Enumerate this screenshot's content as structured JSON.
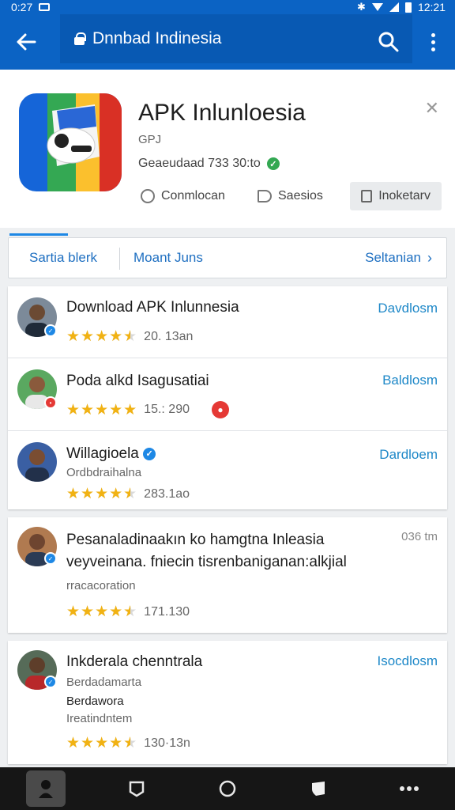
{
  "status_bar": {
    "time": "0:27",
    "right_time": "12:21"
  },
  "app_bar": {
    "title": "Dnnbad Indinesia"
  },
  "app": {
    "title": "APK Inlunloesia",
    "developer": "GPJ",
    "meta": "Geaeudaad 733 30:to",
    "actions": {
      "comment": "Conmlocan",
      "share": "Saesios",
      "install": "Inoketarv"
    }
  },
  "filters": {
    "first": "Sartia blerk",
    "second": "Moant Juns",
    "third": "Seltanian"
  },
  "list_cards": [
    {
      "rows": [
        {
          "title": "Download APK Inlunnesia",
          "rating": 4.5,
          "count": "20. 13an",
          "action": "Davdlosm",
          "badge": "blue"
        },
        {
          "title": "Poda alkd Isagusatiai",
          "rating": 5,
          "count": "15.: 290",
          "action": "Baldlosm",
          "badge": "red"
        },
        {
          "title": "Willagioela",
          "subtitle": "Ordbdraihalna",
          "rating": 4.5,
          "count": "283.1ao",
          "action": "Dardloem",
          "badge": "blue"
        }
      ]
    },
    {
      "rows": [
        {
          "title": "Pesanaladinaakın ko hamgtna Inleasia",
          "line2": "veyveinana. fniecin tisrenbaniganan:alkjial",
          "subtitle": "rracacoration",
          "rating": 4.5,
          "count": "171.130",
          "time": "036 tm",
          "badge": "blue"
        }
      ]
    },
    {
      "rows": [
        {
          "title": "Inkderala chenntrala",
          "subtitle": "Berdadamarta",
          "line2": "Berdawora",
          "subtitle2": "Ireatindntem",
          "rating": 4.5,
          "count": "130·13n",
          "action": "Isocdlosm",
          "badge": "blue"
        }
      ]
    }
  ],
  "colors": {
    "primary": "#0b63c4",
    "accent": "#1e88e5",
    "star": "#f1b213",
    "link": "#1e88c8"
  },
  "icons": [
    "back-arrow-icon",
    "lock-icon",
    "search-icon",
    "overflow-menu-icon",
    "close-icon",
    "comment-icon",
    "share-icon",
    "install-icon",
    "chevron-right-icon",
    "verified-check-icon"
  ]
}
